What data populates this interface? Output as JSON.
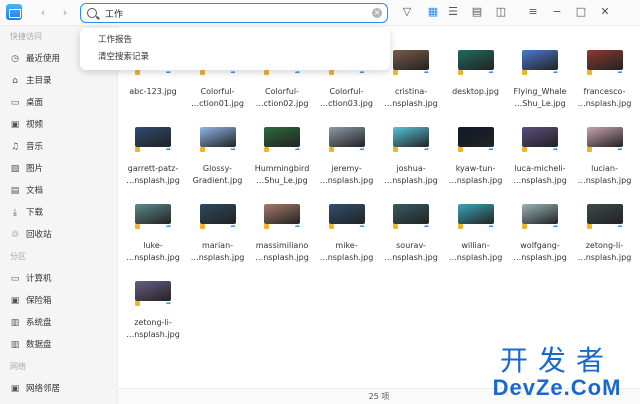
{
  "search": {
    "value": "工作"
  },
  "suggestions": [
    "工作报告",
    "清空搜索记录"
  ],
  "sidebar": {
    "groups": {
      "quick": "快捷访问",
      "partitions": "分区",
      "network": "网络"
    },
    "quick_items": [
      "最近使用",
      "主目录",
      "桌面",
      "视频",
      "音乐",
      "图片",
      "文档",
      "下载",
      "回收站"
    ],
    "partition_items": [
      "计算机",
      "保险箱",
      "系统盘",
      "数据盘"
    ],
    "network_items": [
      "网络邻居"
    ]
  },
  "files": [
    {
      "line1": "abc-123.jpg",
      "line2": "",
      "color": "#9aa4b2"
    },
    {
      "line1": "Colorful-",
      "line2": "…ction01.jpg",
      "color": "#c96a8e"
    },
    {
      "line1": "Colorful-",
      "line2": "…ction02.jpg",
      "color": "#e07a5f"
    },
    {
      "line1": "Colorful-",
      "line2": "…ction03.jpg",
      "color": "#d7a0b6"
    },
    {
      "line1": "cristina-",
      "line2": "…nsplash.jpg",
      "color": "#7a5a48"
    },
    {
      "line1": "desktop.jpg",
      "line2": "",
      "color": "#1f6b5f"
    },
    {
      "line1": "Flying_Whale",
      "line2": "…Shu_Le.jpg",
      "color": "#4a7ad0"
    },
    {
      "line1": "francesco-",
      "line2": "…nsplash.jpg",
      "color": "#8a3a2e"
    },
    {
      "line1": "garrett-patz-",
      "line2": "…nsplash.jpg",
      "color": "#2f4a73"
    },
    {
      "line1": "Glossy-",
      "line2": "Gradient.jpg",
      "color": "#8fb6e8"
    },
    {
      "line1": "Hummingbird",
      "line2": "…Shu_Le.jpg",
      "color": "#2e6a3a"
    },
    {
      "line1": "jeremy-",
      "line2": "…nsplash.jpg",
      "color": "#8d9aa6"
    },
    {
      "line1": "joshua-",
      "line2": "…nsplash.jpg",
      "color": "#56c3d8"
    },
    {
      "line1": "kyaw-tun-",
      "line2": "…nsplash.jpg",
      "color": "#101a2a"
    },
    {
      "line1": "luca-micheli-",
      "line2": "…nsplash.jpg",
      "color": "#5a4f7d"
    },
    {
      "line1": "lucian-",
      "line2": "…nsplash.jpg",
      "color": "#c9a3b0"
    },
    {
      "line1": "luke-",
      "line2": "…nsplash.jpg",
      "color": "#5c8a8c"
    },
    {
      "line1": "marian-",
      "line2": "…nsplash.jpg",
      "color": "#2b4a5e"
    },
    {
      "line1": "massimiliano",
      "line2": "…nsplash.jpg",
      "color": "#a67a6a"
    },
    {
      "line1": "mike-",
      "line2": "…nsplash.jpg",
      "color": "#314e6e"
    },
    {
      "line1": "sourav-",
      "line2": "…nsplash.jpg",
      "color": "#375b63"
    },
    {
      "line1": "willian-",
      "line2": "…nsplash.jpg",
      "color": "#3aa5b8"
    },
    {
      "line1": "wolfgang-",
      "line2": "…nsplash.jpg",
      "color": "#9ab3b8"
    },
    {
      "line1": "zetong-li-",
      "line2": "…nsplash.jpg",
      "color": "#3d4a4a"
    },
    {
      "line1": "zetong-li-",
      "line2": "…nsplash.jpg",
      "color": "#6a5e86"
    }
  ],
  "status": "25 项",
  "watermark": {
    "top": "开发者",
    "bottom": "DevZe.CoM"
  }
}
